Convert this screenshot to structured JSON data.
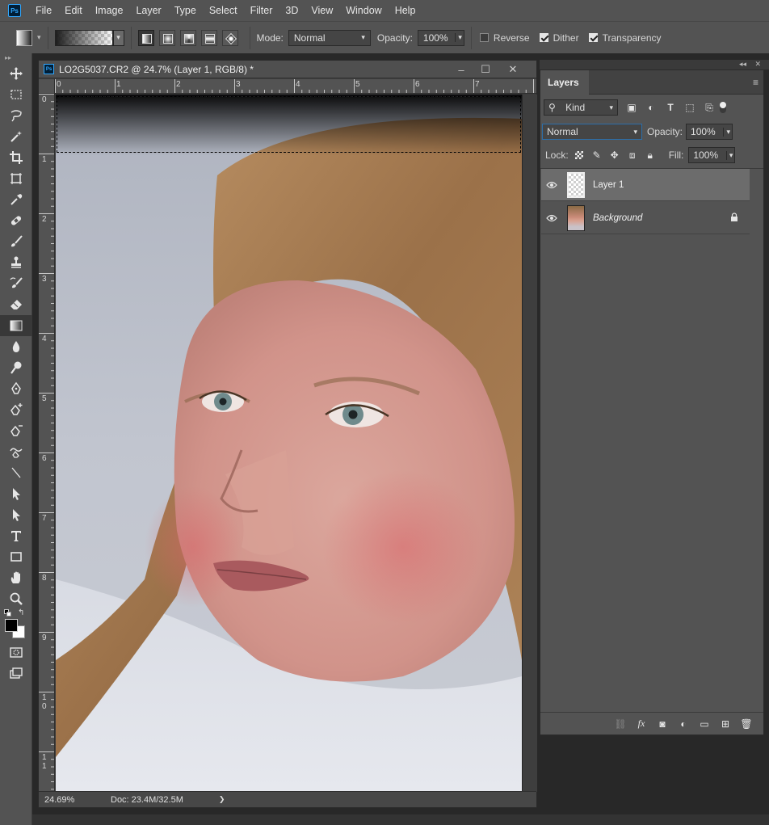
{
  "app": {
    "logo": "Ps"
  },
  "menubar": {
    "items": [
      "File",
      "Edit",
      "Image",
      "Layer",
      "Type",
      "Select",
      "Filter",
      "3D",
      "View",
      "Window",
      "Help"
    ]
  },
  "options": {
    "mode_label": "Mode:",
    "mode_value": "Normal",
    "opacity_label": "Opacity:",
    "opacity_value": "100%",
    "reverse_label": "Reverse",
    "reverse_checked": false,
    "dither_label": "Dither",
    "dither_checked": true,
    "transparency_label": "Transparency",
    "transparency_checked": true,
    "gradient_types": [
      "linear",
      "radial",
      "angle",
      "reflected",
      "diamond"
    ],
    "active_gradient_type": "linear"
  },
  "toolbar": {
    "tools": [
      "move-icon",
      "marquee-icon",
      "lasso-icon",
      "magic-wand-icon",
      "crop-icon",
      "frame-icon",
      "eyedropper-icon",
      "healing-brush-icon",
      "brush-icon",
      "clone-stamp-icon",
      "history-brush-icon",
      "eraser-icon",
      "gradient-icon",
      "blur-icon",
      "dodge-icon",
      "pen-icon",
      "add-anchor-icon",
      "pen-variant-icon",
      "freeform-pen-icon",
      "line-icon",
      "path-selection-icon",
      "direct-selection-icon",
      "type-icon",
      "rectangle-icon",
      "hand-icon",
      "zoom-icon"
    ],
    "active_tool": "gradient-icon",
    "foreground_color": "#000000",
    "background_color": "#ffffff"
  },
  "document": {
    "title": "LO2G5037.CR2 @ 24.7% (Layer 1, RGB/8) *",
    "ruler_h": [
      "0",
      "1",
      "2",
      "3",
      "4",
      "5",
      "6",
      "7"
    ],
    "ruler_v": [
      "0",
      "1",
      "2",
      "3",
      "4",
      "5",
      "6",
      "7",
      "8",
      "9",
      "1\n0",
      "1\n1"
    ],
    "zoom": "24.69%",
    "doc_size": "Doc: 23.4M/32.5M",
    "status_arrow": "❯"
  },
  "layers_panel": {
    "tab": "Layers",
    "filter_kind": "Kind",
    "blend_mode": "Normal",
    "opacity_label": "Opacity:",
    "opacity_value": "100%",
    "lock_label": "Lock:",
    "fill_label": "Fill:",
    "fill_value": "100%",
    "layers": [
      {
        "name": "Layer 1",
        "selected": true,
        "visible": true,
        "locked": false,
        "thumb": "transparent"
      },
      {
        "name": "Background",
        "selected": false,
        "visible": true,
        "locked": true,
        "thumb": "photo"
      }
    ]
  }
}
